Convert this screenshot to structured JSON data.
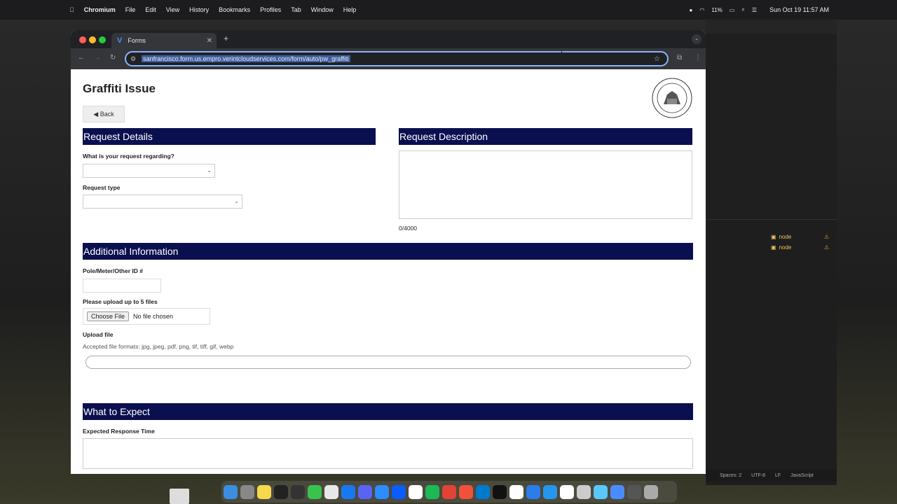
{
  "menubar": {
    "app": "Chromium",
    "items": [
      "File",
      "Edit",
      "View",
      "History",
      "Bookmarks",
      "Profiles",
      "Tab",
      "Window",
      "Help"
    ],
    "battery": "11%",
    "clock": "Sun Oct 19  11:57 AM"
  },
  "browser": {
    "tab_title": "Forms",
    "url": "sanfrancisco.form.us.empro.verintcloudservices.com/form/auto/pw_graffiti"
  },
  "page": {
    "title": "Graffiti Issue",
    "back_label": "◀ Back",
    "request_details": {
      "heading": "Request Details",
      "regarding_label": "What is your request regarding?",
      "regarding_value": "",
      "type_label": "Request type",
      "type_value": ""
    },
    "request_description": {
      "heading": "Request Description",
      "value": "",
      "counter": "0/4000"
    },
    "additional": {
      "heading": "Additional Information",
      "pole_label": "Pole/Meter/Other ID #",
      "pole_value": "",
      "upload_label": "Please upload up to 5 files",
      "choose_file": "Choose File",
      "no_file": "No file chosen",
      "upload_file_label": "Upload file",
      "accepted_formats": "Accepted file formats: jpg, jpeg, pdf, png, tif, tiff, gif, webp"
    },
    "expect": {
      "heading": "What to Expect",
      "response_label": "Expected Response Time"
    }
  },
  "editor": {
    "terminals": [
      "node",
      "node"
    ],
    "status": [
      "Spaces: 2",
      "UTF-8",
      "LF",
      "JavaScript"
    ]
  },
  "colors": {
    "section_header": "#0a0f4f",
    "url_highlight": "#3f5f9f"
  }
}
